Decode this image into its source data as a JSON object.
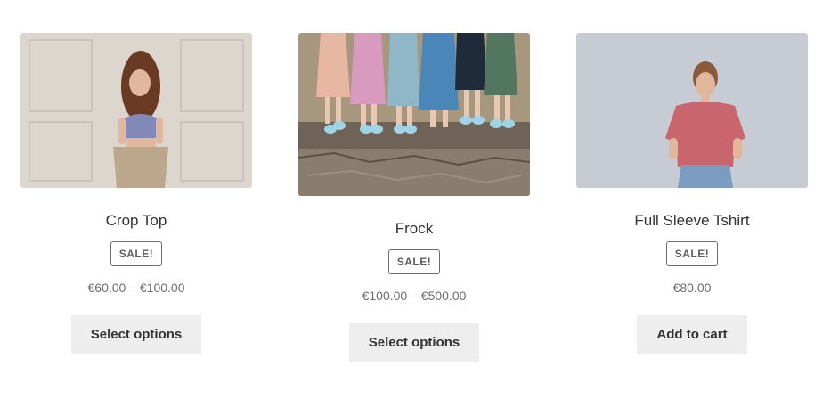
{
  "products": [
    {
      "title": "Crop Top",
      "badge": "SALE!",
      "price": "€60.00 – €100.00",
      "button": "Select options"
    },
    {
      "title": "Frock",
      "badge": "SALE!",
      "price": "€100.00 – €500.00",
      "button": "Select options"
    },
    {
      "title": "Full Sleeve Tshirt",
      "badge": "SALE!",
      "price": "€80.00",
      "button": "Add to cart"
    }
  ]
}
